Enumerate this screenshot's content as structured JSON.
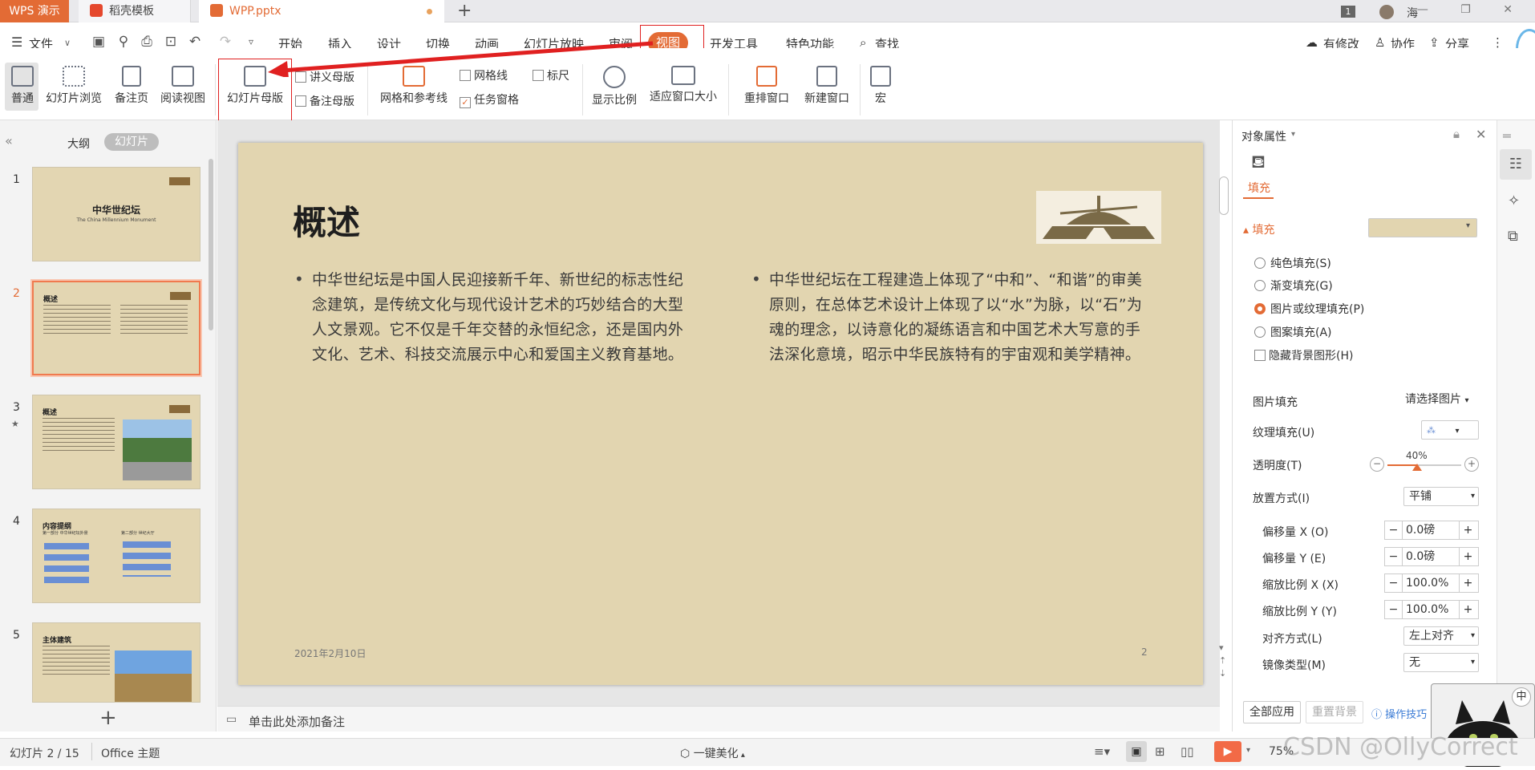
{
  "titlebar": {
    "app": "WPS 演示",
    "tabs": [
      "稻壳模板",
      "WPP.pptx"
    ],
    "new_tab": "+",
    "page_badge": "1",
    "user_name": "海",
    "window_controls": "— ❐ ✕"
  },
  "menubar": {
    "file": "文件",
    "items": [
      "开始",
      "插入",
      "设计",
      "切换",
      "动画",
      "幻灯片放映",
      "审阅",
      "视图",
      "开发工具",
      "特色功能"
    ],
    "search": "查找",
    "right": [
      "有修改",
      "协作",
      "分享"
    ]
  },
  "ribbon": {
    "buttons": [
      "普通",
      "幻灯片浏览",
      "备注页",
      "阅读视图",
      "幻灯片母版"
    ],
    "master_items": [
      "讲义母版",
      "备注母版"
    ],
    "grid_label": "网格和参考线",
    "checks": [
      "网格线",
      "标尺",
      "任务窗格"
    ],
    "view_buttons": [
      "显示比例",
      "适应窗口大小",
      "重排窗口",
      "新建窗口",
      "宏"
    ]
  },
  "leftpanel": {
    "tabs": [
      "大纲",
      "幻灯片"
    ],
    "collapse": "«",
    "add": "+"
  },
  "thumbnails": [
    {
      "num": "1",
      "title": "中华世纪坛",
      "subtitle": "The China Millennium Monument"
    },
    {
      "num": "2",
      "title": "概述"
    },
    {
      "num": "3",
      "title": "概述"
    },
    {
      "num": "4",
      "title": "内容提纲",
      "sub1": "第一部分 中华世纪坛外景",
      "sub2": "第二部分 世纪大厅"
    },
    {
      "num": "5",
      "title": "主体建筑"
    }
  ],
  "slide": {
    "title": "概述",
    "col1": "中华世纪坛是中国人民迎接新千年、新世纪的标志性纪念建筑，是传统文化与现代设计艺术的巧妙结合的大型人文景观。它不仅是千年交替的永恒纪念，还是国内外文化、艺术、科技交流展示中心和爱国主义教育基地。",
    "col2": "中华世纪坛在工程建造上体现了“中和”、“和谐”的审美原则，在总体艺术设计上体现了以“水”为脉，以“石”为魂的理念，以诗意化的凝练语言和中国艺术大写意的手法深化意境，昭示中华民族特有的宇宙观和美学精神。",
    "date": "2021年2月10日",
    "page": "2"
  },
  "notes": {
    "placeholder": "单击此处添加备注"
  },
  "props": {
    "title": "对象属性",
    "fill_tab": "填充",
    "fill_section": "填充",
    "options": [
      "纯色填充(S)",
      "渐变填充(G)",
      "图片或纹理填充(P)",
      "图案填充(A)"
    ],
    "hide_bg": "隐藏背景图形(H)",
    "picture_fill": "图片填充",
    "picture_fill_value": "请选择图片",
    "texture_fill": "纹理填充(U)",
    "transparency": "透明度(T)",
    "transparency_value": "40%",
    "transparency_level": 0.4,
    "placement": "放置方式(I)",
    "placement_value": "平铺",
    "offset_x": "偏移量 X (O)",
    "offset_x_value": "0.0磅",
    "offset_y": "偏移量 Y (E)",
    "offset_y_value": "0.0磅",
    "scale_x": "缩放比例 X (X)",
    "scale_x_value": "100.0%",
    "scale_y": "缩放比例 Y (Y)",
    "scale_y_value": "100.0%",
    "align": "对齐方式(L)",
    "align_value": "左上对齐",
    "mirror": "镜像类型(M)",
    "mirror_value": "无",
    "apply_all": "全部应用",
    "reset_bg": "重置背景",
    "op_tips": "操作技巧"
  },
  "status": {
    "slide_info": "幻灯片 2 / 15",
    "theme": "Office 主题",
    "beautify": "一键美化",
    "zoom": "75%",
    "watermark": "CSDN @OllyCorrect",
    "ime": "中"
  },
  "colors": {
    "accent": "#e36b35",
    "annotation": "#e02020"
  }
}
